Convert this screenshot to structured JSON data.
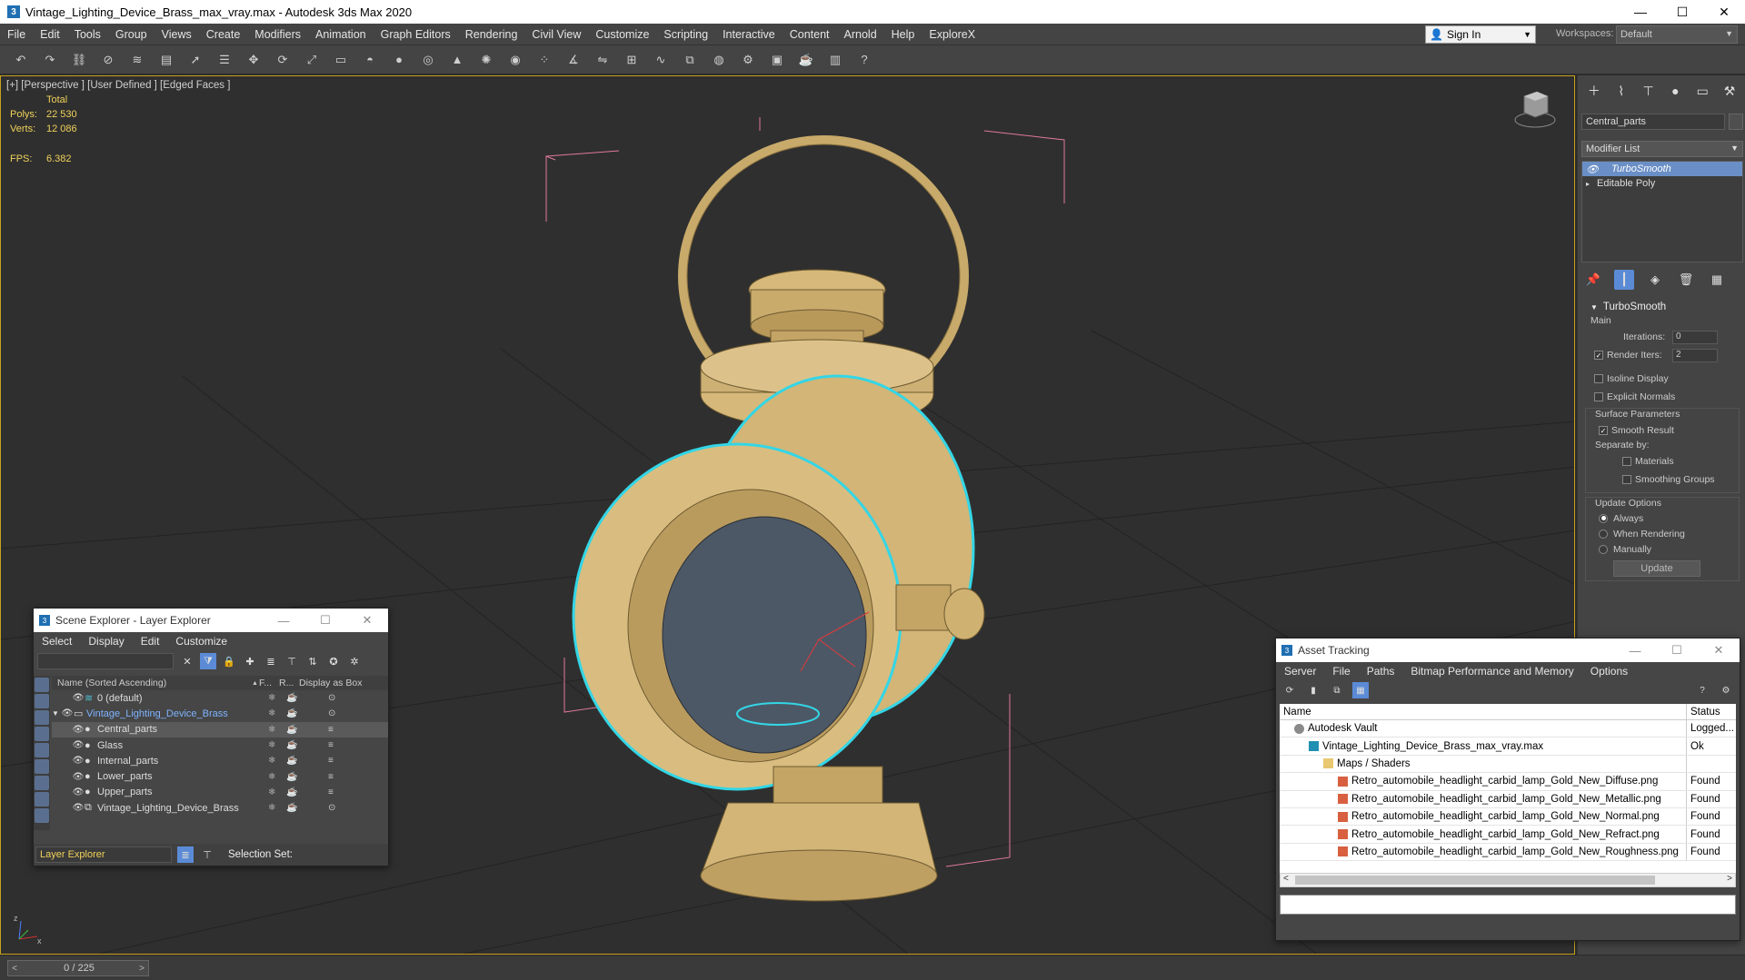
{
  "window": {
    "title": "Vintage_Lighting_Device_Brass_max_vray.max - Autodesk 3ds Max 2020",
    "controls": [
      "—",
      "☐",
      "✕"
    ]
  },
  "menu": [
    "File",
    "Edit",
    "Tools",
    "Group",
    "Views",
    "Create",
    "Modifiers",
    "Animation",
    "Graph Editors",
    "Rendering",
    "Civil View",
    "Customize",
    "Scripting",
    "Interactive",
    "Content",
    "Arnold",
    "Help",
    "ExploreX"
  ],
  "account": {
    "signin": "Sign In",
    "workspaces_label": "Workspaces:",
    "workspace": "Default"
  },
  "viewport": {
    "label": "[+] [Perspective ] [User Defined ] [Edged Faces ]",
    "stats": {
      "total": "Total",
      "polys_label": "Polys:",
      "polys": "22 530",
      "verts_label": "Verts:",
      "verts": "12 086",
      "fps_label": "FPS:",
      "fps": "6.382"
    },
    "axis_labels": {
      "x": "x",
      "y": "y",
      "z": "z"
    }
  },
  "command_panel": {
    "object_name": "Central_parts",
    "modifier_list": "Modifier List",
    "stack": [
      "TurboSmooth",
      "Editable Poly"
    ],
    "rollout": {
      "title": "TurboSmooth",
      "main": "Main",
      "iterations_label": "Iterations:",
      "iterations": "0",
      "render_iters_label": "Render Iters:",
      "render_iters": "2",
      "isoline": "Isoline Display",
      "explicit_normals": "Explicit Normals",
      "surface_params": "Surface Parameters",
      "smooth_result": "Smooth Result",
      "separate_by": "Separate by:",
      "materials": "Materials",
      "smoothing_groups": "Smoothing Groups",
      "update_options": "Update Options",
      "always": "Always",
      "when_rendering": "When Rendering",
      "manually": "Manually",
      "update_button": "Update"
    }
  },
  "scene_explorer": {
    "title": "Scene Explorer - Layer Explorer",
    "menu": [
      "Select",
      "Display",
      "Edit",
      "Customize"
    ],
    "columns": {
      "name": "Name (Sorted Ascending)",
      "sort": "▲",
      "f": "F...",
      "r": "R...",
      "box": "Display as Box"
    },
    "rows": [
      {
        "name": "0 (default)",
        "level": 1
      },
      {
        "name": "Vintage_Lighting_Device_Brass",
        "level": 0
      },
      {
        "name": "Central_parts",
        "level": 2
      },
      {
        "name": "Glass",
        "level": 2
      },
      {
        "name": "Internal_parts",
        "level": 2
      },
      {
        "name": "Lower_parts",
        "level": 2
      },
      {
        "name": "Upper_parts",
        "level": 2
      },
      {
        "name": "Vintage_Lighting_Device_Brass",
        "level": 2
      }
    ],
    "footer_combo": "Layer Explorer",
    "selection_set": "Selection Set:"
  },
  "asset_tracking": {
    "title": "Asset Tracking",
    "menu": [
      "Server",
      "File",
      "Paths",
      "Bitmap Performance and Memory",
      "Options"
    ],
    "columns": {
      "name": "Name",
      "status": "Status"
    },
    "rows": [
      {
        "name": "Autodesk Vault",
        "status": "Logged..."
      },
      {
        "name": "Vintage_Lighting_Device_Brass_max_vray.max",
        "status": "Ok"
      },
      {
        "name": "Maps / Shaders",
        "status": ""
      },
      {
        "name": "Retro_automobile_headlight_carbid_lamp_Gold_New_Diffuse.png",
        "status": "Found"
      },
      {
        "name": "Retro_automobile_headlight_carbid_lamp_Gold_New_Metallic.png",
        "status": "Found"
      },
      {
        "name": "Retro_automobile_headlight_carbid_lamp_Gold_New_Normal.png",
        "status": "Found"
      },
      {
        "name": "Retro_automobile_headlight_carbid_lamp_Gold_New_Refract.png",
        "status": "Found"
      },
      {
        "name": "Retro_automobile_headlight_carbid_lamp_Gold_New_Roughness.png",
        "status": "Found"
      }
    ]
  },
  "timeline": {
    "frame": "0 / 225",
    "prev": "<",
    "next": ">"
  },
  "colors": {
    "accent": "#5b8bd6",
    "selection_outline": "#33d6e6",
    "stats": "#f0d25a",
    "brass": "#d6b97a",
    "viewport_bg": "#2f2f2f"
  }
}
